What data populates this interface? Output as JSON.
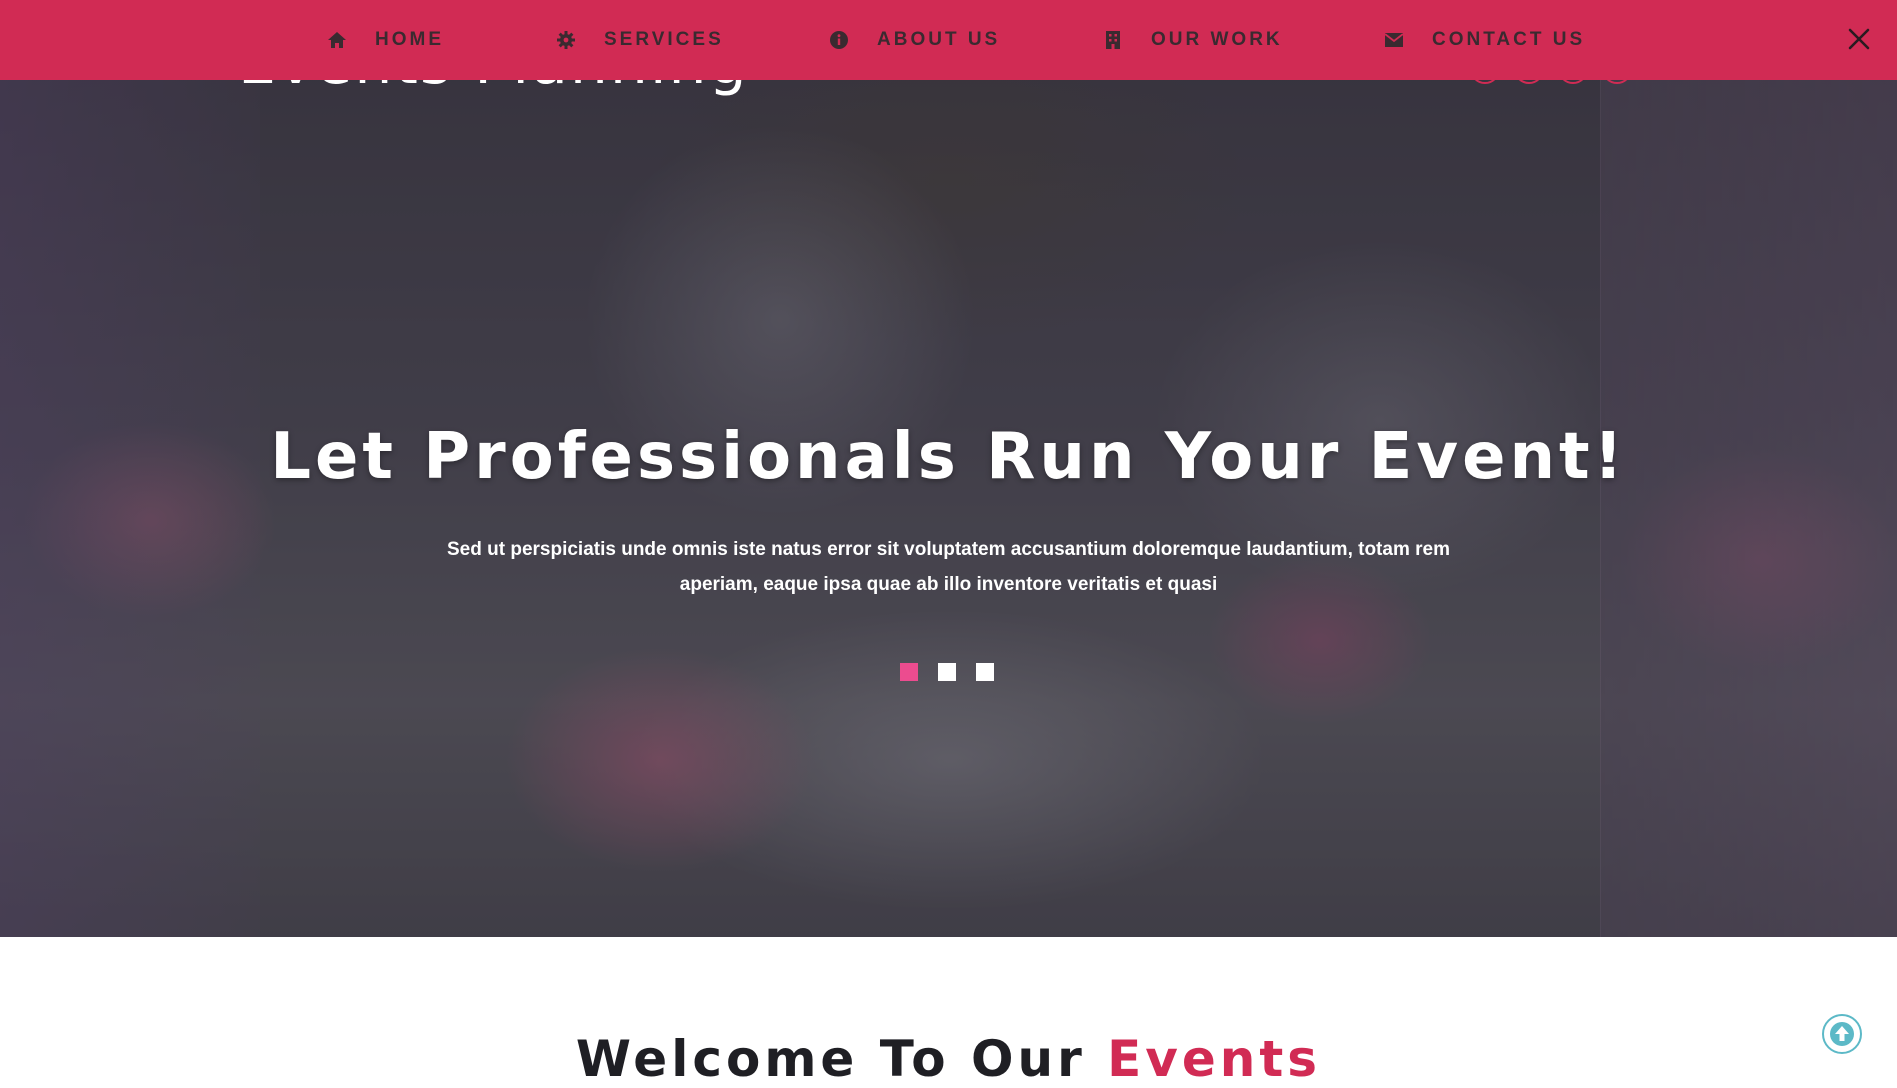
{
  "brand": {
    "partial_text": "Events Planning"
  },
  "nav": {
    "items": [
      {
        "label": "HOME",
        "icon": "home-icon"
      },
      {
        "label": "SERVICES",
        "icon": "gear-icon"
      },
      {
        "label": "ABOUT US",
        "icon": "info-icon"
      },
      {
        "label": "OUR WORK",
        "icon": "building-icon"
      },
      {
        "label": "CONTACT US",
        "icon": "envelope-icon"
      }
    ],
    "close_icon": "close-icon"
  },
  "hero": {
    "title": "Let Professionals Run Your Event!",
    "text": "Sed ut perspiciatis unde omnis iste natus error sit voluptatem accusantium doloremque laudantium, totam rem aperiam, eaque ipsa quae ab illo inventore veritatis et quasi",
    "slider_dots": 3,
    "active_dot": 1
  },
  "welcome": {
    "prefix": "Welcome To Our ",
    "accent": "Events"
  },
  "to_top_icon": "arrow-up-circle-icon",
  "colors": {
    "nav_bg": "#d12b54",
    "nav_text": "#3a2a30",
    "accent": "#d12b54",
    "active_dot": "#ec4c8f",
    "to_top": "#5cb9c7"
  }
}
